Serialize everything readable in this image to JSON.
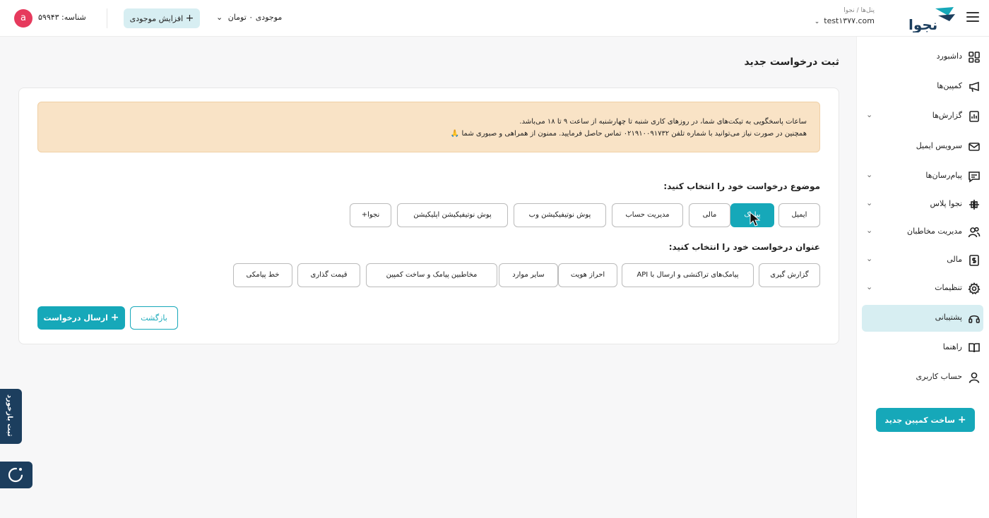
{
  "header": {
    "breadcrumb": "پنل‌ها / نجوا",
    "account_email": "test۱۳۷۷.com",
    "balance_label": "موجودی ۰ تومان",
    "increase_balance_label": "افزایش موجودی",
    "user_id_label": "شناسه: ۵۹۹۴۳",
    "avatar_letter": "a",
    "logo_text": "نجوا"
  },
  "sidebar": {
    "items": [
      {
        "label": "داشبورد",
        "icon": "dashboard-icon",
        "has_chevron": false
      },
      {
        "label": "کمپین‌ها",
        "icon": "megaphone-icon",
        "has_chevron": false
      },
      {
        "label": "گزارش‌ها",
        "icon": "report-icon",
        "has_chevron": true
      },
      {
        "label": "سرویس ایمیل",
        "icon": "mail-icon",
        "has_chevron": false
      },
      {
        "label": "پیام‌رسان‌ها",
        "icon": "message-icon",
        "has_chevron": true
      },
      {
        "label": "نجوا پلاس",
        "icon": "plus-service-icon",
        "has_chevron": true
      },
      {
        "label": "مدیریت مخاطبان",
        "icon": "contacts-icon",
        "has_chevron": true
      },
      {
        "label": "مالی",
        "icon": "invoice-icon",
        "has_chevron": true
      },
      {
        "label": "تنظیمات",
        "icon": "gear-icon",
        "has_chevron": true
      },
      {
        "label": "پشتیبانی",
        "icon": "headset-icon",
        "has_chevron": false
      },
      {
        "label": "راهنما",
        "icon": "book-icon",
        "has_chevron": false
      },
      {
        "label": "حساب کاربری",
        "icon": "user-icon",
        "has_chevron": false
      }
    ],
    "active_index": 9,
    "new_campaign_label": "ساخت کمپین جدید"
  },
  "main": {
    "title": "ثبت درخواست جدید",
    "notice_line1": "ساعات پاسخگویی به تیکت‌های شما، در روزهای کاری شنبه تا چهارشنبه از ساعت ۹ تا ۱۸ می‌باشد.",
    "notice_line2": "همچنین در صورت نیاز می‌توانید با شماره تلفن ۰۲۱۹۱۰۰۹۱۷۳۲ تماس حاصل فرمایید. ممنون از همراهی و صبوری شما 🙏",
    "subject_label": "موضوع درخواست خود را انتخاب کنید:",
    "subjects": [
      "ایمیل",
      "پیامک",
      "مالی",
      "مدیریت حساب",
      "پوش نوتیفیکیشن وب",
      "پوش نوتیفیکیشن اپلیکیشن",
      "نجوا+"
    ],
    "selected_subject": "پیامک",
    "title_label": "عنوان درخواست خود را انتخاب کنید:",
    "titles": [
      "گزارش گیری",
      "پیامک‌های تراکنشی و ارسال با API",
      "احراز هویت",
      "سایر موارد",
      "مخاطبین پیامک و ساخت کمپین",
      "قیمت گذاری",
      "خط پیامکی"
    ],
    "submit_label": "ارسال درخواست",
    "back_label": "بازگشت"
  },
  "floating": {
    "feedback_label": "ثبت بازخورد"
  },
  "colors": {
    "accent": "#16a8b9",
    "accent_light": "#d7eef2",
    "notice_bg": "#f9e3c6",
    "avatar": "#e63a5d",
    "floating_bg": "#1c3e5e"
  }
}
